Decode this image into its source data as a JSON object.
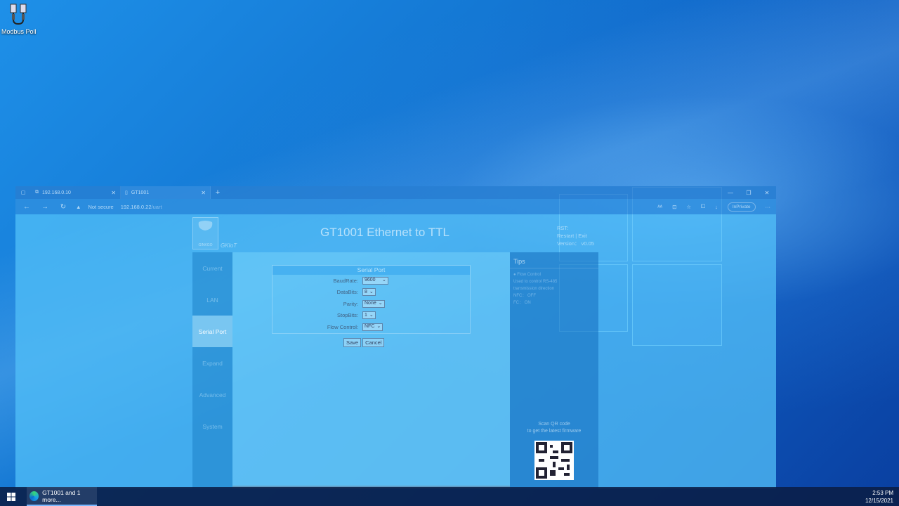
{
  "desktop": {
    "icon_label": "Modbus Poll"
  },
  "browser": {
    "tabs": [
      {
        "title": "192.168.0.10"
      },
      {
        "title": "GT1001"
      }
    ],
    "new_tab": "+",
    "security_label": "Not secure",
    "url_host": "192.168.0.22",
    "url_path": "/uart",
    "inprivate_label": "InPrivate"
  },
  "page": {
    "brand": "GINKGO",
    "sub_brand": "GKIoT",
    "title": "GT1001  Ethernet to TTL",
    "top_right": {
      "line1": "RST:",
      "line2": "Restart | Exit",
      "line3": "Version： v0.05"
    },
    "nav": [
      "Current",
      "LAN",
      "Serial Port",
      "Expand",
      "Advanced",
      "System"
    ],
    "nav_active": "Serial Port",
    "form": {
      "header": "Serial Port",
      "rows": [
        {
          "label": "BaudRate:",
          "value": "9600"
        },
        {
          "label": "DataBits:",
          "value": "8"
        },
        {
          "label": "Parity:",
          "value": "None"
        },
        {
          "label": "StopBits:",
          "value": "1"
        },
        {
          "label": "Flow Control:",
          "value": "NFC"
        }
      ],
      "save_label": "Save",
      "cancel_label": "Cancel"
    },
    "tips": {
      "header": "Tips",
      "lines": [
        "● Flow Control",
        "Used to control RS-485",
        "transmission direction",
        "NFC： OFF",
        "FC： ON"
      ],
      "scan_line1": "Scan QR code",
      "scan_line2": "to get the latest firmware"
    }
  },
  "taskbar": {
    "app_label": "GT1001 and 1 more...",
    "time": "2:53 PM",
    "date": "12/15/2021"
  }
}
